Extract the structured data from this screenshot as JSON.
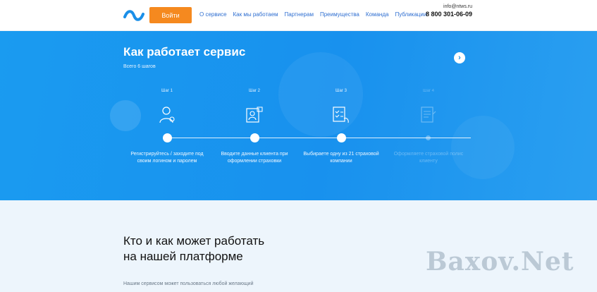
{
  "header": {
    "login_label": "Войти",
    "nav": [
      "О сервисе",
      "Как мы работаем",
      "Партнерам",
      "Преимущества",
      "Команда",
      "Публикации"
    ],
    "email": "info@ntws.ru",
    "phone": "8 800 301-06-09"
  },
  "hero": {
    "title": "Как работает сервис",
    "subtitle": "Всего 6 шагов",
    "steps": [
      {
        "label": "Шаг 1",
        "text": "Регистрируйтесь / заходите под своим логином и паролем",
        "icon": "user-icon"
      },
      {
        "label": "Шаг 2",
        "text": "Вводите данные клиента при оформлении страховки",
        "icon": "id-card-icon"
      },
      {
        "label": "Шаг 3",
        "text": "Выбираете одну из 21 страховой компании",
        "icon": "checklist-icon"
      },
      {
        "label": "Шаг 4",
        "text": "Оформляете страховой полис клиенту",
        "icon": "document-icon"
      }
    ]
  },
  "lower": {
    "title_line1": "Кто и как может работать",
    "title_line2": "на нашей платформе",
    "description": "Нашим сервисом может пользоваться любой желающий"
  },
  "watermark": "Baxov.Net",
  "colors": {
    "accent": "#f5891f",
    "hero_blue": "#1a9bf0",
    "nav_blue": "#2f6fd1"
  }
}
